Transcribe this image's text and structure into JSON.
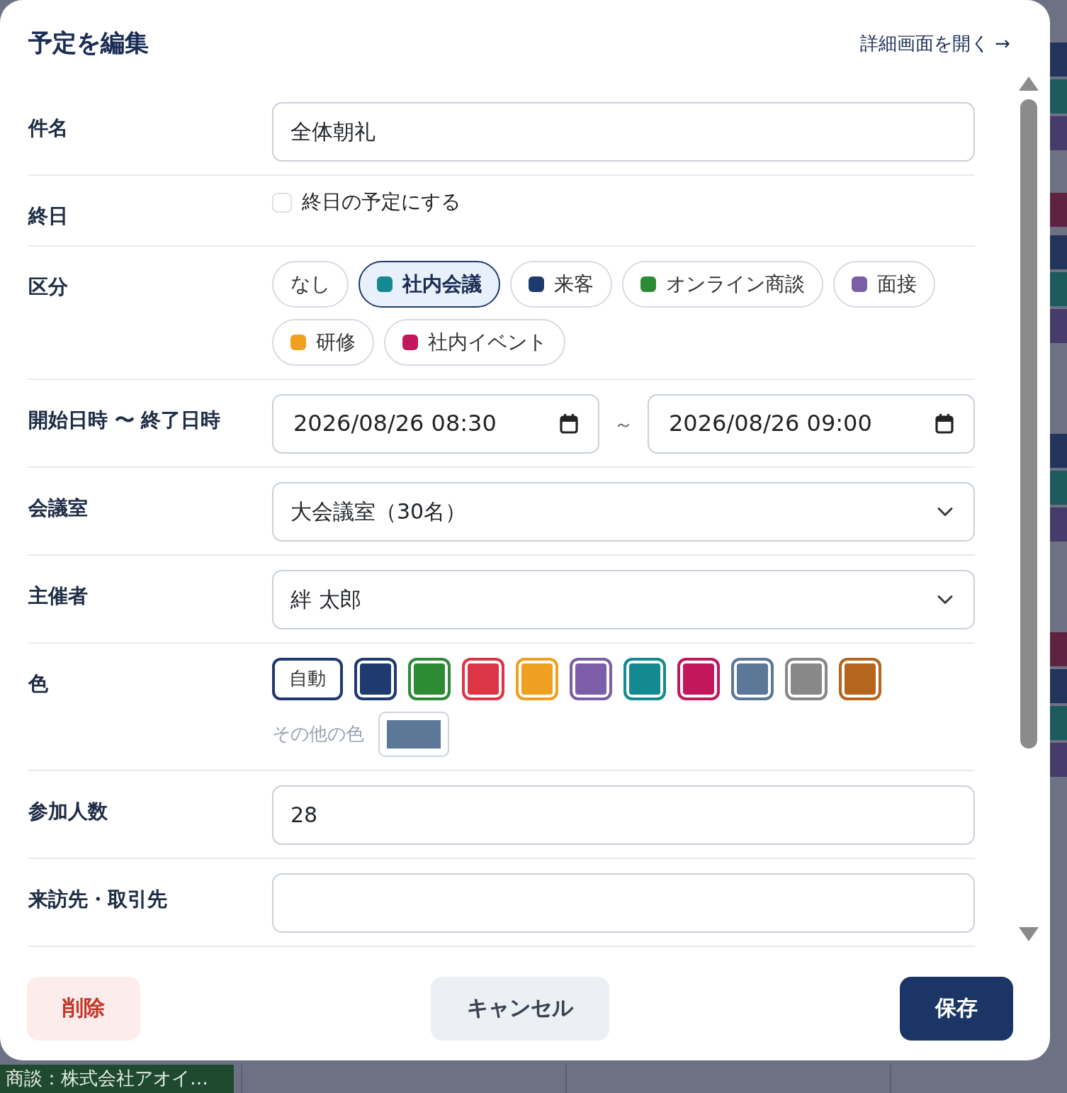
{
  "background": {
    "right_chips": [
      {
        "color": "#22345c"
      },
      {
        "color": "#1d5a5d"
      },
      {
        "color": "#463b6b"
      },
      {
        "color": "#5e2341"
      },
      {
        "color": "#22345c"
      },
      {
        "color": "#1d5a5d"
      },
      {
        "color": "#463b6b"
      },
      {
        "color": "#22345c"
      },
      {
        "color": "#1d5a5d"
      },
      {
        "color": "#463b6b"
      },
      {
        "color": "#5e2341"
      },
      {
        "color": "#22345c"
      },
      {
        "color": "#1d5a5d"
      },
      {
        "color": "#463b6b"
      }
    ],
    "bottom_chip": {
      "text": "商談：株式会社アオイ…",
      "color": "#1f4a30"
    }
  },
  "dialog": {
    "title": "予定を編集",
    "detail_link": "詳細画面を開く →"
  },
  "fields": [
    {
      "kind": "text",
      "label": "件名",
      "value": "全体朝礼"
    },
    {
      "kind": "checkbox",
      "label": "終日",
      "option": "終日の予定にする",
      "checked": false
    },
    {
      "kind": "chips",
      "label": "区分",
      "options": [
        {
          "text": "なし",
          "selected": false
        },
        {
          "text": "社内会議",
          "color": "#138a8f",
          "selected": true
        },
        {
          "text": "来客",
          "color": "#1e3a6e",
          "selected": false
        },
        {
          "text": "オンライン商談",
          "color": "#2e8b35",
          "selected": false
        },
        {
          "text": "面接",
          "color": "#7b5ea7",
          "selected": false
        },
        {
          "text": "研修",
          "color": "#f0a020",
          "selected": false
        },
        {
          "text": "社内イベント",
          "color": "#c2185b",
          "selected": false
        }
      ]
    },
    {
      "kind": "daterange",
      "label": "開始日時 〜 終了日時",
      "start": "2026/08/26 08:30",
      "separator": "～",
      "end": "2026/08/26 09:00"
    },
    {
      "kind": "select",
      "label": "会議室",
      "value": "大会議室（30名）"
    },
    {
      "kind": "select",
      "label": "主催者",
      "value": "絆 太郎"
    },
    {
      "kind": "colors",
      "label": "色",
      "other": {
        "label": "その他の色",
        "color": "#5b7896"
      },
      "swatches": [
        {
          "kind": "auto",
          "text": "自動",
          "selected": true
        },
        {
          "kind": "color",
          "color": "#1e3a6e",
          "selected": false
        },
        {
          "kind": "color",
          "color": "#2e8b35",
          "selected": false
        },
        {
          "kind": "color",
          "color": "#dc3545",
          "selected": false
        },
        {
          "kind": "color",
          "color": "#f0a020",
          "selected": false
        },
        {
          "kind": "color",
          "color": "#7b5ea7",
          "selected": false
        },
        {
          "kind": "color",
          "color": "#138a8f",
          "selected": false
        },
        {
          "kind": "color",
          "color": "#c2185b",
          "selected": false
        },
        {
          "kind": "color",
          "color": "#5b7896",
          "selected": false
        },
        {
          "kind": "color",
          "color": "#888888",
          "selected": false
        },
        {
          "kind": "color",
          "color": "#b5651d",
          "selected": false
        }
      ]
    },
    {
      "kind": "text",
      "label": "参加人数",
      "value": "28"
    },
    {
      "kind": "text",
      "label": "来訪先・取引先"
    }
  ],
  "buttons": [
    {
      "kind": "danger",
      "text": "削除"
    },
    {
      "kind": "secondary",
      "text": "キャンセル"
    },
    {
      "kind": "primary",
      "text": "保存"
    }
  ]
}
